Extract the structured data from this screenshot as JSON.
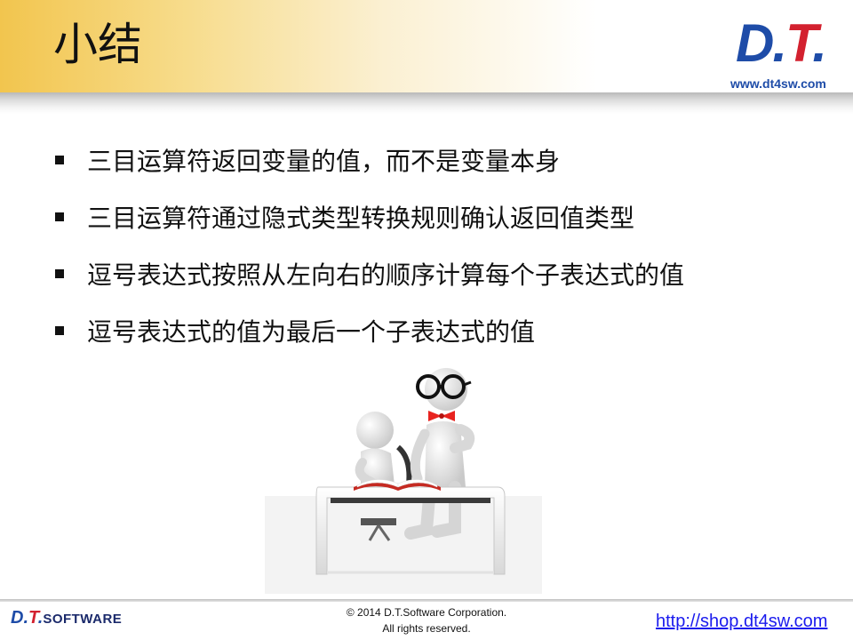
{
  "header": {
    "title": "小结",
    "logo": {
      "d": "D",
      "dot1": ".",
      "t": "T",
      "dot2": "."
    },
    "logo_url": "www.dt4sw.com"
  },
  "bullets": [
    "三目运算符返回变量的值，而不是变量本身",
    "三目运算符通过隐式类型转换规则确认返回值类型",
    "逗号表达式按照从左向右的顺序计算每个子表达式的值",
    "逗号表达式的值为最后一个子表达式的值"
  ],
  "footer": {
    "logo": {
      "d": "D",
      "dot1": ".",
      "t": "T",
      "dot2": ".",
      "software": "SOFTWARE"
    },
    "copyright_line1": "© 2014 D.T.Software Corporation.",
    "copyright_line2": "All rights reserved.",
    "url": "http://shop.dt4sw.com"
  },
  "colors": {
    "brand_blue": "#1e4ca8",
    "brand_red": "#d3212f",
    "header_gold": "#f2c54e",
    "link_blue": "#1a1aee"
  },
  "icons": [
    "bullet-square-icon",
    "reading-figures-illustration"
  ]
}
